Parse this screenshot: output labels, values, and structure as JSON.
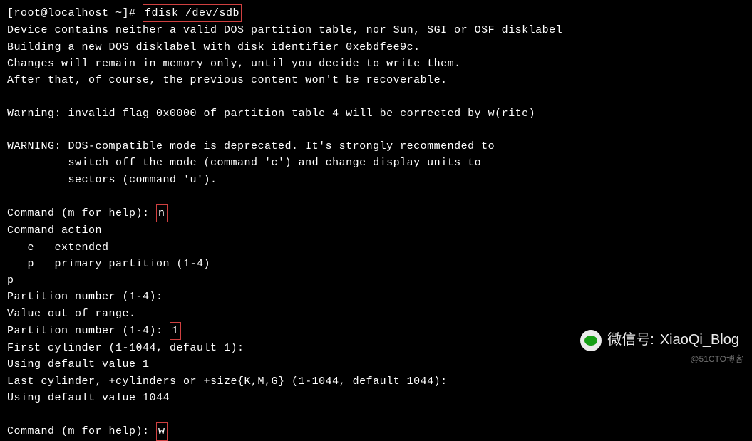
{
  "terminal": {
    "prompt_line": {
      "prompt": "[root@localhost ~]# ",
      "command": "fdisk /dev/sdb"
    },
    "output": {
      "l1": "Device contains neither a valid DOS partition table, nor Sun, SGI or OSF disklabel",
      "l2": "Building a new DOS disklabel with disk identifier 0xebdfee9c.",
      "l3": "Changes will remain in memory only, until you decide to write them.",
      "l4": "After that, of course, the previous content won't be recoverable.",
      "l5": "",
      "l6": "Warning: invalid flag 0x0000 of partition table 4 will be corrected by w(rite)",
      "l7": "",
      "l8": "WARNING: DOS-compatible mode is deprecated. It's strongly recommended to",
      "l9": "         switch off the mode (command 'c') and change display units to",
      "l10": "         sectors (command 'u').",
      "l11": "",
      "l12a": "Command (m for help): ",
      "l12b": "n",
      "l13": "Command action",
      "l14": "   e   extended",
      "l15": "   p   primary partition (1-4)",
      "l16": "p",
      "l17": "Partition number (1-4):",
      "l18": "Value out of range.",
      "l19a": "Partition number (1-4): ",
      "l19b": "1",
      "l20": "First cylinder (1-1044, default 1):",
      "l21": "Using default value 1",
      "l22": "Last cylinder, +cylinders or +size{K,M,G} (1-1044, default 1044):",
      "l23": "Using default value 1044",
      "l24": "",
      "l25a": "Command (m for help): ",
      "l25b": "w"
    }
  },
  "watermark": {
    "label": "微信号:",
    "handle": "XiaoQi_Blog"
  },
  "attribution": "@51CTO博客"
}
